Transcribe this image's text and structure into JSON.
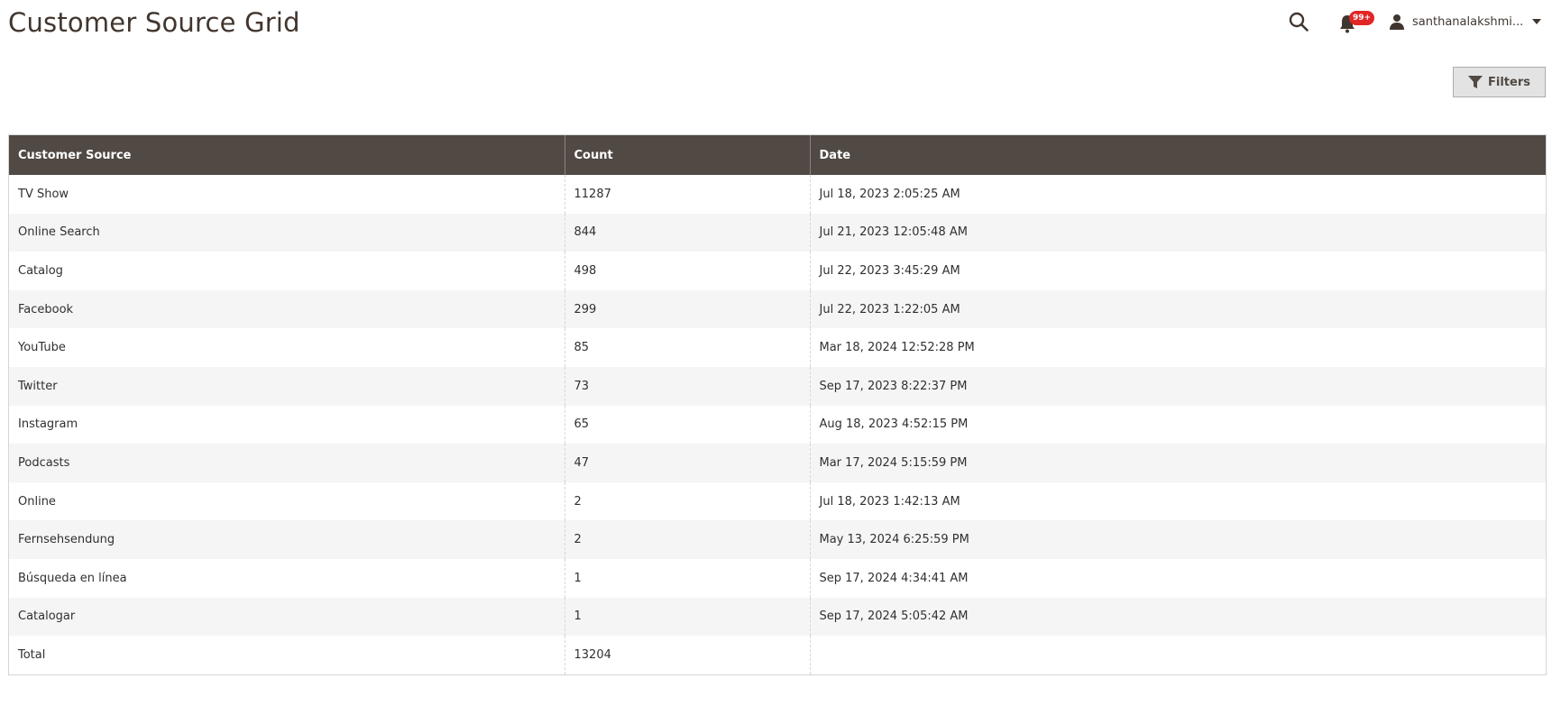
{
  "page": {
    "title": "Customer Source Grid"
  },
  "header": {
    "notification_badge": "99+",
    "user_name": "santhanalakshmi...",
    "filters_label": "Filters"
  },
  "table": {
    "columns": [
      "Customer Source",
      "Count",
      "Date"
    ],
    "rows": [
      {
        "source": "TV Show",
        "count": "11287",
        "date": "Jul 18, 2023 2:05:25 AM"
      },
      {
        "source": "Online Search",
        "count": "844",
        "date": "Jul 21, 2023 12:05:48 AM"
      },
      {
        "source": "Catalog",
        "count": "498",
        "date": "Jul 22, 2023 3:45:29 AM"
      },
      {
        "source": "Facebook",
        "count": "299",
        "date": "Jul 22, 2023 1:22:05 AM"
      },
      {
        "source": "YouTube",
        "count": "85",
        "date": "Mar 18, 2024 12:52:28 PM"
      },
      {
        "source": "Twitter",
        "count": "73",
        "date": "Sep 17, 2023 8:22:37 PM"
      },
      {
        "source": "Instagram",
        "count": "65",
        "date": "Aug 18, 2023 4:52:15 PM"
      },
      {
        "source": "Podcasts",
        "count": "47",
        "date": "Mar 17, 2024 5:15:59 PM"
      },
      {
        "source": "Online",
        "count": "2",
        "date": "Jul 18, 2023 1:42:13 AM"
      },
      {
        "source": "Fernsehsendung",
        "count": "2",
        "date": "May 13, 2024 6:25:59 PM"
      },
      {
        "source": "Búsqueda en línea",
        "count": "1",
        "date": "Sep 17, 2024 4:34:41 AM"
      },
      {
        "source": "Catalogar",
        "count": "1",
        "date": "Sep 17, 2024 5:05:42 AM"
      }
    ],
    "total": {
      "label": "Total",
      "count": "13204",
      "date": ""
    }
  },
  "icons": {
    "search": "search-icon",
    "notifications": "bell-icon",
    "user": "user-icon",
    "dropdown": "caret-down-icon",
    "filter": "filter-icon"
  },
  "colors": {
    "header_bg": "#514943",
    "badge": "#e22626",
    "title": "#41362f"
  }
}
